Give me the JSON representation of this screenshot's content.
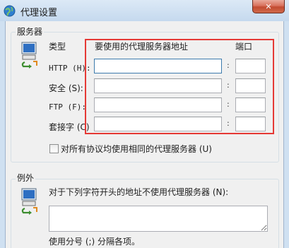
{
  "window": {
    "title": "代理设置",
    "close_symbol": "✕",
    "app_icon": "proxy-settings-icon"
  },
  "servers": {
    "group_title": "服务器",
    "icon": "network-computer-icon",
    "col_type": "类型",
    "col_address": "要使用的代理服务器地址",
    "col_port": "端口",
    "rows": [
      {
        "label": "HTTP (H):",
        "address": "",
        "port": ""
      },
      {
        "label": "安全 (S):",
        "address": "",
        "port": ""
      },
      {
        "label": "FTP (F):",
        "address": "",
        "port": ""
      },
      {
        "label": "套接字 (C)",
        "address": "",
        "port": ""
      }
    ],
    "port_separator": ":",
    "same_proxy_label": "对所有协议均使用相同的代理服务器 (U)",
    "same_proxy_checked": false,
    "highlight_color": "#e53935"
  },
  "exceptions": {
    "group_title": "例外",
    "icon": "network-computer-icon",
    "label": "对于下列字符开头的地址不使用代理服务器 (N):",
    "value": "",
    "hint": "使用分号 (;) 分隔各项。"
  }
}
